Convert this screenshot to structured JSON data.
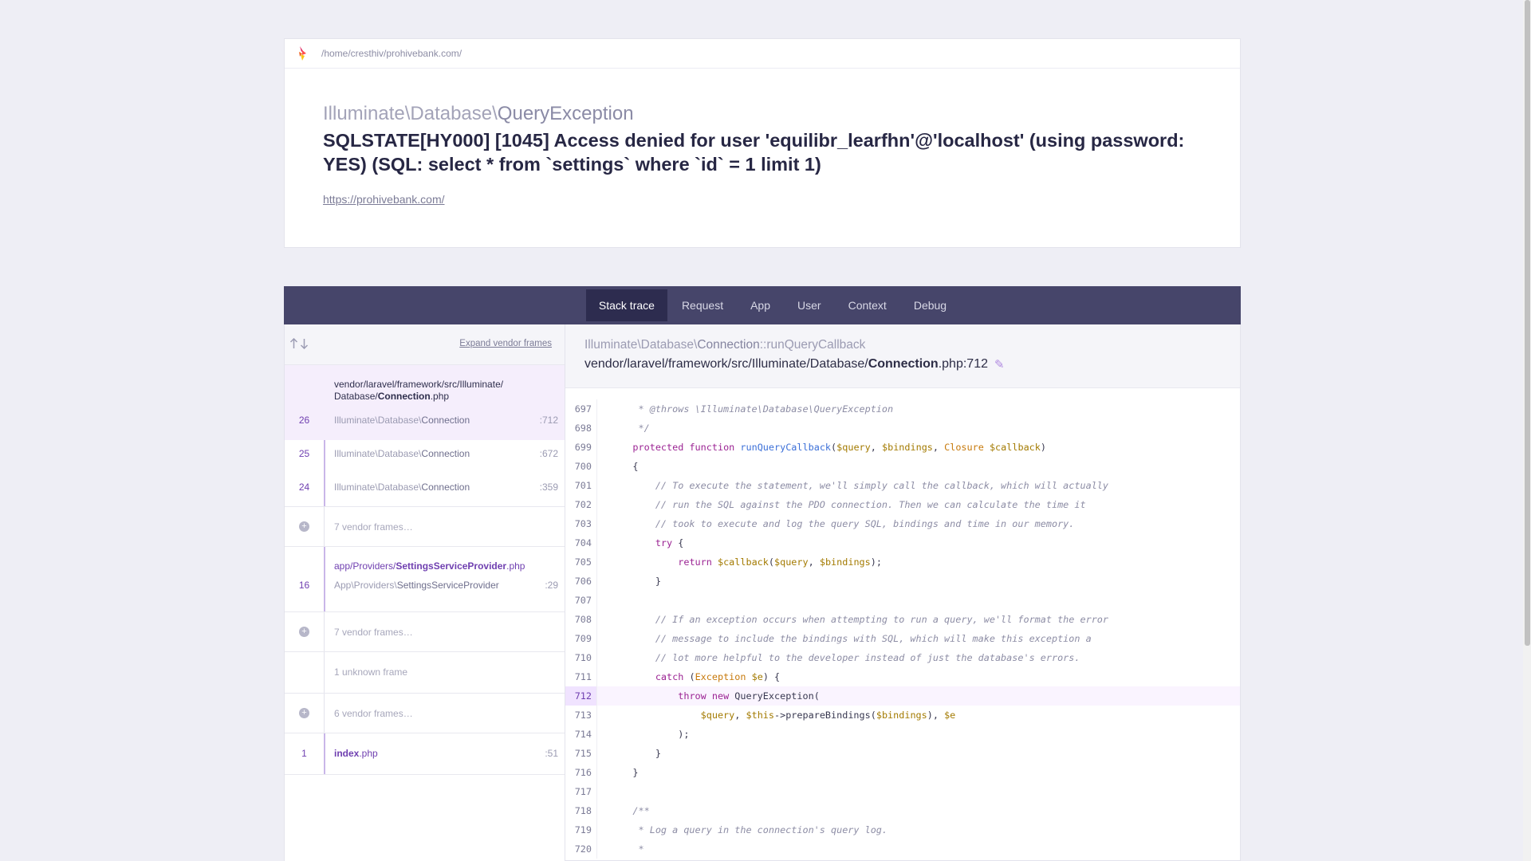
{
  "header": {
    "path": "/home/cresthiv/prohivebank.com/",
    "exception_namespace": "Illuminate\\Database\\",
    "exception_short": "QueryException",
    "message": "SQLSTATE[HY000] [1045] Access denied for user 'equilibr_learfhn'@'localhost' (using password: YES) (SQL: select * from `settings` where `id` = 1 limit 1)",
    "url": "https://prohivebank.com/"
  },
  "tabs": [
    {
      "label": "Stack trace",
      "active": true
    },
    {
      "label": "Request"
    },
    {
      "label": "App"
    },
    {
      "label": "User"
    },
    {
      "label": "Context"
    },
    {
      "label": "Debug"
    }
  ],
  "frames": {
    "expand_label": "Expand vendor frames",
    "group1": {
      "file_dir": "vendor/laravel/framework/src/Illuminate/\nDatabase/",
      "file_name": "Connection",
      "file_ext": ".php",
      "rows": [
        {
          "num": "26",
          "ns": "Illuminate\\Database\\",
          "cls": "Connection",
          "line": ":712"
        },
        {
          "num": "25",
          "ns": "Illuminate\\Database\\",
          "cls": "Connection",
          "line": ":672"
        },
        {
          "num": "24",
          "ns": "Illuminate\\Database\\",
          "cls": "Connection",
          "line": ":359"
        }
      ]
    },
    "vendor1": "7 vendor frames…",
    "group2": {
      "file_dir": "app/Providers/",
      "file_name": "SettingsServiceProvider",
      "file_ext": ".php",
      "row": {
        "num": "16",
        "ns": "App\\Providers\\",
        "cls": "SettingsServiceProvider",
        "line": ":29"
      }
    },
    "vendor2": "7 vendor frames…",
    "unknown": "1 unknown frame",
    "vendor3": "6 vendor frames…",
    "group3": {
      "num": "1",
      "file_name": "index",
      "file_ext": ".php",
      "line": ":51"
    }
  },
  "code": {
    "ns": "Illuminate\\Database\\",
    "cls": "Connection",
    "method": "::runQueryCallback",
    "file_dir": "vendor/laravel/framework/src/Illuminate/Database/",
    "file_name": "Connection",
    "file_ext": ".php:712",
    "highlight_line": "712",
    "lines": [
      {
        "n": "697",
        "t": "     * @throws \\Illuminate\\Database\\QueryException"
      },
      {
        "n": "698",
        "t": "     */"
      },
      {
        "n": "699",
        "t": "    protected function runQueryCallback($query, $bindings, Closure $callback)"
      },
      {
        "n": "700",
        "t": "    {"
      },
      {
        "n": "701",
        "t": "        // To execute the statement, we'll simply call the callback, which will actually"
      },
      {
        "n": "702",
        "t": "        // run the SQL against the PDO connection. Then we can calculate the time it"
      },
      {
        "n": "703",
        "t": "        // took to execute and log the query SQL, bindings and time in our memory."
      },
      {
        "n": "704",
        "t": "        try {"
      },
      {
        "n": "705",
        "t": "            return $callback($query, $bindings);"
      },
      {
        "n": "706",
        "t": "        }"
      },
      {
        "n": "707",
        "t": ""
      },
      {
        "n": "708",
        "t": "        // If an exception occurs when attempting to run a query, we'll format the error"
      },
      {
        "n": "709",
        "t": "        // message to include the bindings with SQL, which will make this exception a"
      },
      {
        "n": "710",
        "t": "        // lot more helpful to the developer instead of just the database's errors."
      },
      {
        "n": "711",
        "t": "        catch (Exception $e) {"
      },
      {
        "n": "712",
        "t": "            throw new QueryException("
      },
      {
        "n": "713",
        "t": "                $query, $this->prepareBindings($bindings), $e"
      },
      {
        "n": "714",
        "t": "            );"
      },
      {
        "n": "715",
        "t": "        }"
      },
      {
        "n": "716",
        "t": "    }"
      },
      {
        "n": "717",
        "t": ""
      },
      {
        "n": "718",
        "t": "    /**"
      },
      {
        "n": "719",
        "t": "     * Log a query in the connection's query log."
      },
      {
        "n": "720",
        "t": "     *"
      }
    ]
  },
  "colors": {
    "tab_bar": "#46456a",
    "tab_active": "#2d2c4f",
    "accent": "#6f3fb0",
    "highlight": "#f0e3ff"
  },
  "icons": {
    "logo": "ignition-flame-logo",
    "sort": "arrow-up-down-icon",
    "edit": "pencil-icon",
    "expand": "plus-circle-icon"
  }
}
